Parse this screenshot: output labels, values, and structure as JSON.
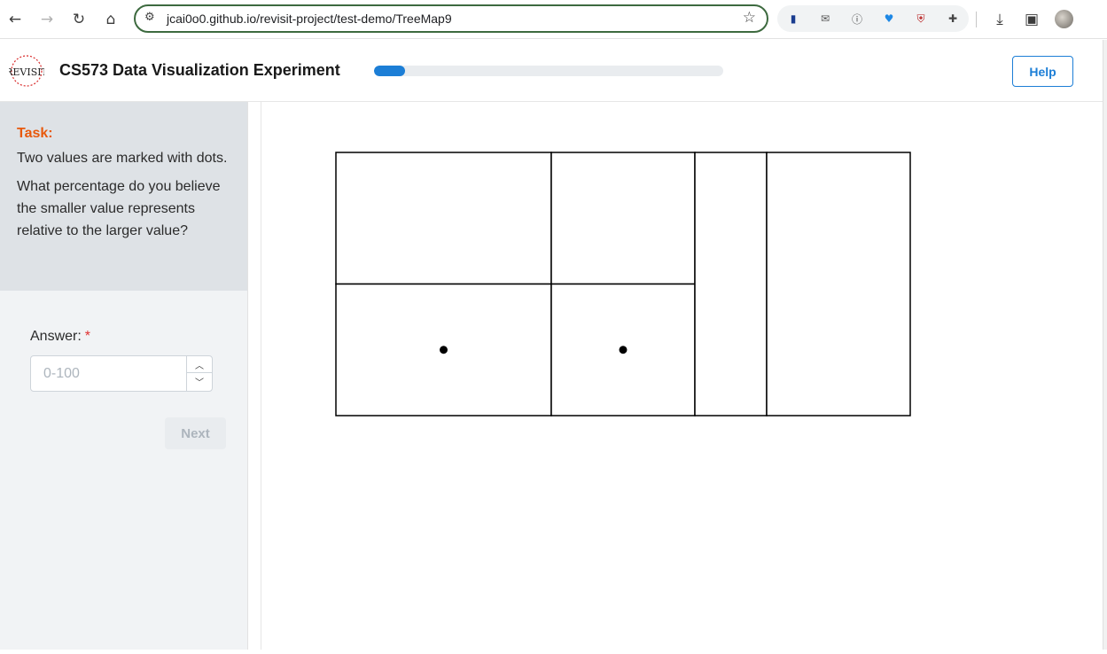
{
  "browser": {
    "url": "jcai0o0.github.io/revisit-project/test-demo/TreeMap9",
    "icons": [
      "back-icon",
      "forward-icon",
      "reload-icon",
      "home-icon",
      "site-settings-icon",
      "bookmark-star-icon",
      "extensions-icon",
      "download-icon",
      "side-panel-icon",
      "profile-avatar"
    ]
  },
  "header": {
    "logo_text": "REVISIT",
    "title": "CS573 Data Visualization Experiment",
    "progress_fraction": 0.09,
    "help_label": "Help"
  },
  "task": {
    "label": "Task:",
    "paragraph1": "Two values are marked with dots.",
    "paragraph2": "What percentage do you believe the smaller value represents relative to the larger value?"
  },
  "answer": {
    "label": "Answer:",
    "required_mark": "*",
    "placeholder": "0-100",
    "value": ""
  },
  "next_label": "Next",
  "colors": {
    "accent": "#1c7ed6",
    "task_label": "#e8590c",
    "required": "#e03131",
    "task_bg": "#dee2e6",
    "sidebar_bg": "#f1f3f5"
  },
  "chart_data": {
    "type": "treemap",
    "cells": [
      {
        "id": "A",
        "x0": 0,
        "y0": 0,
        "x1": 0.375,
        "y1": 0.5,
        "marked": false
      },
      {
        "id": "B",
        "x0": 0,
        "y0": 0.5,
        "x1": 0.375,
        "y1": 1,
        "marked": true
      },
      {
        "id": "C",
        "x0": 0.375,
        "y0": 0,
        "x1": 0.625,
        "y1": 0.5,
        "marked": false
      },
      {
        "id": "D",
        "x0": 0.375,
        "y0": 0.5,
        "x1": 0.625,
        "y1": 1,
        "marked": true
      },
      {
        "id": "E",
        "x0": 0.625,
        "y0": 0,
        "x1": 0.75,
        "y1": 1,
        "marked": false
      },
      {
        "id": "F",
        "x0": 0.75,
        "y0": 0,
        "x1": 1,
        "y1": 1,
        "marked": false
      }
    ]
  }
}
